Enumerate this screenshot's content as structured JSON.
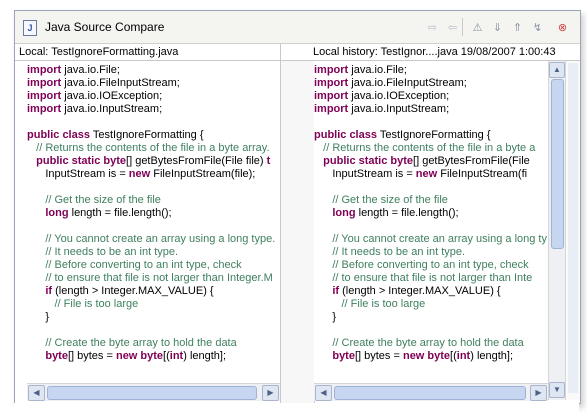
{
  "window": {
    "title": "Java Source Compare",
    "icon_letter": "J",
    "toolbar": [
      {
        "name": "copy-all-left-to-right-icon",
        "glyph": "⇨",
        "enabled": false
      },
      {
        "name": "copy-all-right-to-left-icon",
        "glyph": "⇦",
        "enabled": false
      },
      {
        "name": "ignore-whitespace-icon",
        "glyph": "⚠",
        "enabled": true
      },
      {
        "name": "next-difference-icon",
        "glyph": "⇓",
        "enabled": true
      },
      {
        "name": "previous-difference-icon",
        "glyph": "⇑",
        "enabled": true
      },
      {
        "name": "next-change-icon",
        "glyph": "↯",
        "enabled": true
      },
      {
        "name": "close-icon",
        "glyph": "⊗",
        "enabled": true
      }
    ]
  },
  "left": {
    "header": "Local: TestIgnoreFormatting.java",
    "lines": [
      [
        [
          "kw",
          "import"
        ],
        [
          "t",
          " java.io.File;"
        ]
      ],
      [
        [
          "kw",
          "import"
        ],
        [
          "t",
          " java.io.FileInputStream;"
        ]
      ],
      [
        [
          "kw",
          "import"
        ],
        [
          "t",
          " java.io.IOException;"
        ]
      ],
      [
        [
          "kw",
          "import"
        ],
        [
          "t",
          " java.io.InputStream;"
        ]
      ],
      [
        [
          "t",
          ""
        ]
      ],
      [
        [
          "kw",
          "public class"
        ],
        [
          "t",
          " TestIgnoreFormatting {"
        ]
      ],
      [
        [
          "cm",
          "   // Returns the contents of the file in a byte array."
        ]
      ],
      [
        [
          "t",
          "   "
        ],
        [
          "kw",
          "public static byte"
        ],
        [
          "t",
          "[] getBytesFromFile(File file) "
        ],
        [
          "kw",
          "t"
        ]
      ],
      [
        [
          "t",
          "      InputStream is = "
        ],
        [
          "kw",
          "new"
        ],
        [
          "t",
          " FileInputStream(file);"
        ]
      ],
      [
        [
          "t",
          ""
        ]
      ],
      [
        [
          "cm",
          "      // Get the size of the file"
        ]
      ],
      [
        [
          "t",
          "      "
        ],
        [
          "kw",
          "long"
        ],
        [
          "t",
          " length = file.length();"
        ]
      ],
      [
        [
          "t",
          ""
        ]
      ],
      [
        [
          "cm",
          "      // You cannot create an array using a long type."
        ]
      ],
      [
        [
          "cm",
          "      // It needs to be an int type."
        ]
      ],
      [
        [
          "cm",
          "      // Before converting to an int type, check"
        ]
      ],
      [
        [
          "cm",
          "      // to ensure that file is not larger than Integer.M"
        ]
      ],
      [
        [
          "t",
          "      "
        ],
        [
          "kw",
          "if"
        ],
        [
          "t",
          " (length > Integer.MAX_VALUE) {"
        ]
      ],
      [
        [
          "cm",
          "         // File is too large"
        ]
      ],
      [
        [
          "t",
          "      }"
        ]
      ],
      [
        [
          "t",
          ""
        ]
      ],
      [
        [
          "cm",
          "      // Create the byte array to hold the data"
        ]
      ],
      [
        [
          "t",
          "      "
        ],
        [
          "kw",
          "byte"
        ],
        [
          "t",
          "[] bytes = "
        ],
        [
          "kw",
          "new byte"
        ],
        [
          "t",
          "[("
        ],
        [
          "kw",
          "int"
        ],
        [
          "t",
          ") length];"
        ]
      ]
    ]
  },
  "right": {
    "header": "Local history: TestIgnor....java 19/08/2007 1:00:43",
    "lines": [
      [
        [
          "kw",
          "import"
        ],
        [
          "t",
          " java.io.File;"
        ]
      ],
      [
        [
          "kw",
          "import"
        ],
        [
          "t",
          " java.io.FileInputStream;"
        ]
      ],
      [
        [
          "kw",
          "import"
        ],
        [
          "t",
          " java.io.IOException;"
        ]
      ],
      [
        [
          "kw",
          "import"
        ],
        [
          "t",
          " java.io.InputStream;"
        ]
      ],
      [
        [
          "t",
          ""
        ]
      ],
      [
        [
          "kw",
          "public class"
        ],
        [
          "t",
          " TestIgnoreFormatting {"
        ]
      ],
      [
        [
          "cm",
          "   // Returns the contents of the file in a byte a"
        ]
      ],
      [
        [
          "t",
          "   "
        ],
        [
          "kw",
          "public static byte"
        ],
        [
          "t",
          "[] getBytesFromFile(File"
        ]
      ],
      [
        [
          "t",
          "      InputStream is = "
        ],
        [
          "kw",
          "new"
        ],
        [
          "t",
          " FileInputStream(fi"
        ]
      ],
      [
        [
          "t",
          ""
        ]
      ],
      [
        [
          "cm",
          "      // Get the size of the file"
        ]
      ],
      [
        [
          "t",
          "      "
        ],
        [
          "kw",
          "long"
        ],
        [
          "t",
          " length = file.length();"
        ]
      ],
      [
        [
          "t",
          ""
        ]
      ],
      [
        [
          "cm",
          "      // You cannot create an array using a long ty"
        ]
      ],
      [
        [
          "cm",
          "      // It needs to be an int type."
        ]
      ],
      [
        [
          "cm",
          "      // Before converting to an int type, check"
        ]
      ],
      [
        [
          "cm",
          "      // to ensure that file is not larger than Inte"
        ]
      ],
      [
        [
          "t",
          "      "
        ],
        [
          "kw",
          "if"
        ],
        [
          "t",
          " (length > Integer.MAX_VALUE) {"
        ]
      ],
      [
        [
          "cm",
          "         // File is too large"
        ]
      ],
      [
        [
          "t",
          "      }"
        ]
      ],
      [
        [
          "t",
          ""
        ]
      ],
      [
        [
          "cm",
          "      // Create the byte array to hold the data"
        ]
      ],
      [
        [
          "t",
          "      "
        ],
        [
          "kw",
          "byte"
        ],
        [
          "t",
          "[] bytes = "
        ],
        [
          "kw",
          "new byte"
        ],
        [
          "t",
          "[("
        ],
        [
          "kw",
          "int"
        ],
        [
          "t",
          ") length];"
        ]
      ]
    ]
  },
  "scroll": {
    "left_left_arrow": "◀",
    "left_right_arrow": "▶",
    "right_left_arrow": "◀",
    "right_right_arrow": "▶",
    "up_arrow": "▲",
    "down_arrow": "▼"
  },
  "colors": {
    "keyword": "#7f0055",
    "comment": "#3f7f5f",
    "text": "#000000"
  }
}
